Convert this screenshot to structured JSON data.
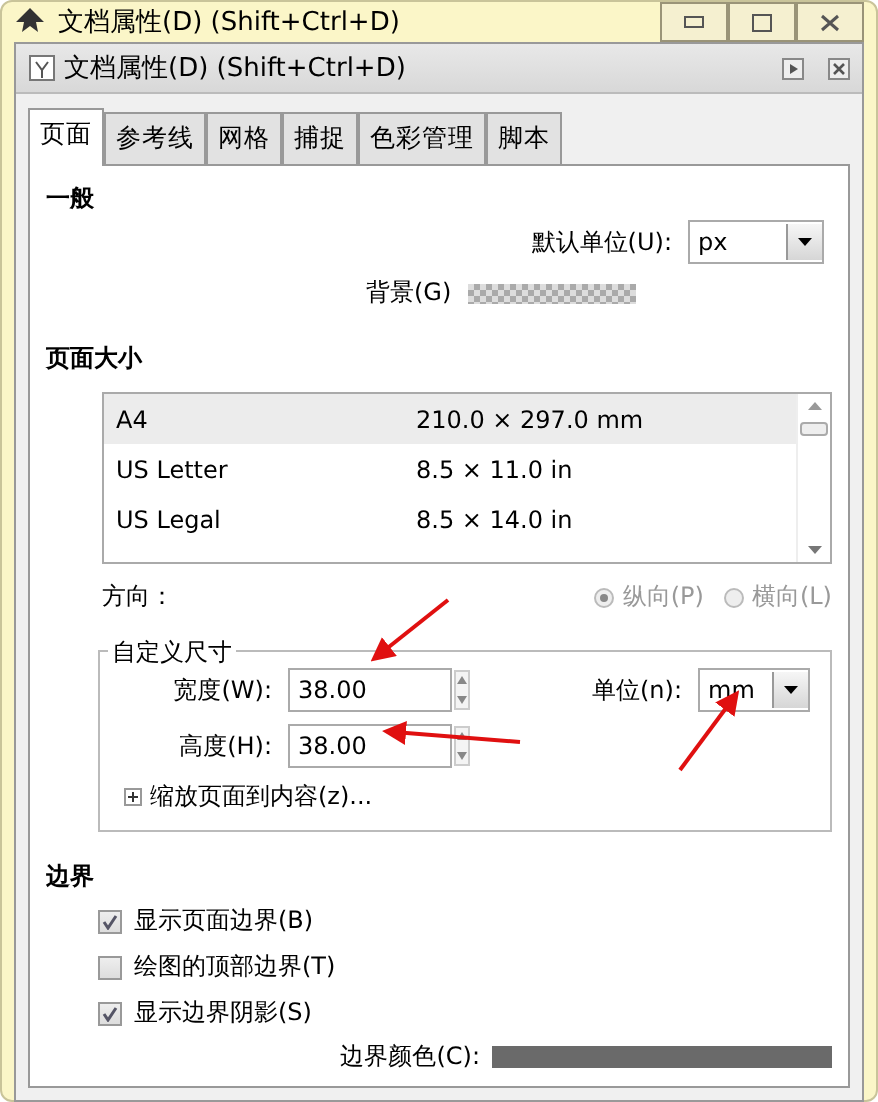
{
  "window": {
    "title": "文档属性(D) (Shift+Ctrl+D)"
  },
  "dialog": {
    "title": "文档属性(D) (Shift+Ctrl+D)"
  },
  "tabs": [
    {
      "label": "页面",
      "selected": true
    },
    {
      "label": "参考线",
      "selected": false
    },
    {
      "label": "网格",
      "selected": false
    },
    {
      "label": "捕捉",
      "selected": false
    },
    {
      "label": "色彩管理",
      "selected": false
    },
    {
      "label": "脚本",
      "selected": false
    }
  ],
  "general": {
    "heading": "一般",
    "default_unit": {
      "label": "默认单位(U):",
      "value": "px"
    },
    "background": {
      "label": "背景(G)"
    }
  },
  "page_size": {
    "heading": "页面大小",
    "rows": [
      {
        "name": "A4",
        "size": "210.0 × 297.0 mm",
        "selected": true
      },
      {
        "name": "US Letter",
        "size": "8.5 × 11.0 in",
        "selected": false
      },
      {
        "name": "US Legal",
        "size": "8.5 × 14.0 in",
        "selected": false
      }
    ],
    "orientation": {
      "label": "方向：",
      "disabled": true,
      "options": [
        {
          "label": "纵向(P)",
          "selected": true
        },
        {
          "label": "横向(L)",
          "selected": false
        }
      ]
    }
  },
  "custom_size": {
    "legend": "自定义尺寸",
    "width": {
      "label": "宽度(W):",
      "value": "38.00"
    },
    "height": {
      "label": "高度(H):",
      "value": "38.00"
    },
    "unit": {
      "label": "单位(n):",
      "value": "mm"
    },
    "scale": {
      "label": "缩放页面到内容(z)...",
      "expanded": false
    }
  },
  "border": {
    "heading": "边界",
    "options": [
      {
        "label": "显示页面边界(B)",
        "checked": true
      },
      {
        "label": "绘图的顶部边界(T)",
        "checked": false
      },
      {
        "label": "显示边界阴影(S)",
        "checked": true
      }
    ],
    "color": {
      "label": "边界颜色(C):"
    }
  }
}
